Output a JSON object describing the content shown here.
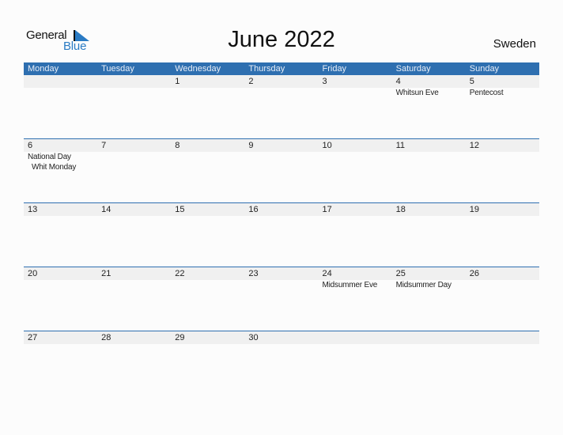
{
  "logo": {
    "word1": "General",
    "word2": "Blue"
  },
  "title": "June 2022",
  "country": "Sweden",
  "colors": {
    "header_bg": "#2e6fb0",
    "accent": "#2a7bc4",
    "row_band": "#f0f0f0"
  },
  "weekdays": [
    "Monday",
    "Tuesday",
    "Wednesday",
    "Thursday",
    "Friday",
    "Saturday",
    "Sunday"
  ],
  "weeks": [
    {
      "days": [
        {
          "num": "",
          "holidays": []
        },
        {
          "num": "",
          "holidays": []
        },
        {
          "num": "1",
          "holidays": []
        },
        {
          "num": "2",
          "holidays": []
        },
        {
          "num": "3",
          "holidays": []
        },
        {
          "num": "4",
          "holidays": [
            "Whitsun Eve"
          ]
        },
        {
          "num": "5",
          "holidays": [
            "Pentecost"
          ]
        }
      ]
    },
    {
      "days": [
        {
          "num": "6",
          "holidays": [
            "National Day",
            "Whit Monday"
          ]
        },
        {
          "num": "7",
          "holidays": []
        },
        {
          "num": "8",
          "holidays": []
        },
        {
          "num": "9",
          "holidays": []
        },
        {
          "num": "10",
          "holidays": []
        },
        {
          "num": "11",
          "holidays": []
        },
        {
          "num": "12",
          "holidays": []
        }
      ]
    },
    {
      "days": [
        {
          "num": "13",
          "holidays": []
        },
        {
          "num": "14",
          "holidays": []
        },
        {
          "num": "15",
          "holidays": []
        },
        {
          "num": "16",
          "holidays": []
        },
        {
          "num": "17",
          "holidays": []
        },
        {
          "num": "18",
          "holidays": []
        },
        {
          "num": "19",
          "holidays": []
        }
      ]
    },
    {
      "days": [
        {
          "num": "20",
          "holidays": []
        },
        {
          "num": "21",
          "holidays": []
        },
        {
          "num": "22",
          "holidays": []
        },
        {
          "num": "23",
          "holidays": []
        },
        {
          "num": "24",
          "holidays": [
            "Midsummer Eve"
          ]
        },
        {
          "num": "25",
          "holidays": [
            "Midsummer Day"
          ]
        },
        {
          "num": "26",
          "holidays": []
        }
      ]
    },
    {
      "days": [
        {
          "num": "27",
          "holidays": []
        },
        {
          "num": "28",
          "holidays": []
        },
        {
          "num": "29",
          "holidays": []
        },
        {
          "num": "30",
          "holidays": []
        },
        {
          "num": "",
          "holidays": []
        },
        {
          "num": "",
          "holidays": []
        },
        {
          "num": "",
          "holidays": []
        }
      ]
    }
  ]
}
